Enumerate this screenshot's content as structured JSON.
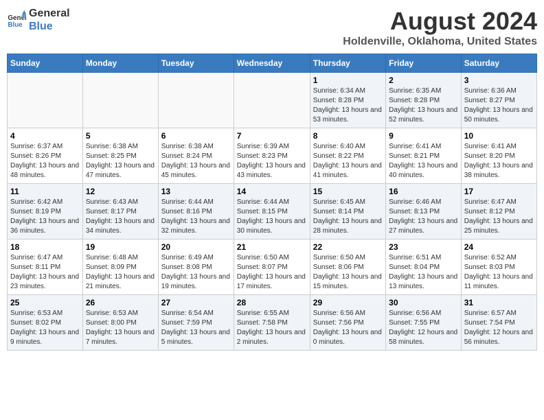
{
  "logo": {
    "line1": "General",
    "line2": "Blue"
  },
  "title": "August 2024",
  "subtitle": "Holdenville, Oklahoma, United States",
  "days_of_week": [
    "Sunday",
    "Monday",
    "Tuesday",
    "Wednesday",
    "Thursday",
    "Friday",
    "Saturday"
  ],
  "weeks": [
    [
      {
        "day": "",
        "sunrise": "",
        "sunset": "",
        "daylight": ""
      },
      {
        "day": "",
        "sunrise": "",
        "sunset": "",
        "daylight": ""
      },
      {
        "day": "",
        "sunrise": "",
        "sunset": "",
        "daylight": ""
      },
      {
        "day": "",
        "sunrise": "",
        "sunset": "",
        "daylight": ""
      },
      {
        "day": "1",
        "sunrise": "Sunrise: 6:34 AM",
        "sunset": "Sunset: 8:28 PM",
        "daylight": "Daylight: 13 hours and 53 minutes."
      },
      {
        "day": "2",
        "sunrise": "Sunrise: 6:35 AM",
        "sunset": "Sunset: 8:28 PM",
        "daylight": "Daylight: 13 hours and 52 minutes."
      },
      {
        "day": "3",
        "sunrise": "Sunrise: 6:36 AM",
        "sunset": "Sunset: 8:27 PM",
        "daylight": "Daylight: 13 hours and 50 minutes."
      }
    ],
    [
      {
        "day": "4",
        "sunrise": "Sunrise: 6:37 AM",
        "sunset": "Sunset: 8:26 PM",
        "daylight": "Daylight: 13 hours and 48 minutes."
      },
      {
        "day": "5",
        "sunrise": "Sunrise: 6:38 AM",
        "sunset": "Sunset: 8:25 PM",
        "daylight": "Daylight: 13 hours and 47 minutes."
      },
      {
        "day": "6",
        "sunrise": "Sunrise: 6:38 AM",
        "sunset": "Sunset: 8:24 PM",
        "daylight": "Daylight: 13 hours and 45 minutes."
      },
      {
        "day": "7",
        "sunrise": "Sunrise: 6:39 AM",
        "sunset": "Sunset: 8:23 PM",
        "daylight": "Daylight: 13 hours and 43 minutes."
      },
      {
        "day": "8",
        "sunrise": "Sunrise: 6:40 AM",
        "sunset": "Sunset: 8:22 PM",
        "daylight": "Daylight: 13 hours and 41 minutes."
      },
      {
        "day": "9",
        "sunrise": "Sunrise: 6:41 AM",
        "sunset": "Sunset: 8:21 PM",
        "daylight": "Daylight: 13 hours and 40 minutes."
      },
      {
        "day": "10",
        "sunrise": "Sunrise: 6:41 AM",
        "sunset": "Sunset: 8:20 PM",
        "daylight": "Daylight: 13 hours and 38 minutes."
      }
    ],
    [
      {
        "day": "11",
        "sunrise": "Sunrise: 6:42 AM",
        "sunset": "Sunset: 8:19 PM",
        "daylight": "Daylight: 13 hours and 36 minutes."
      },
      {
        "day": "12",
        "sunrise": "Sunrise: 6:43 AM",
        "sunset": "Sunset: 8:17 PM",
        "daylight": "Daylight: 13 hours and 34 minutes."
      },
      {
        "day": "13",
        "sunrise": "Sunrise: 6:44 AM",
        "sunset": "Sunset: 8:16 PM",
        "daylight": "Daylight: 13 hours and 32 minutes."
      },
      {
        "day": "14",
        "sunrise": "Sunrise: 6:44 AM",
        "sunset": "Sunset: 8:15 PM",
        "daylight": "Daylight: 13 hours and 30 minutes."
      },
      {
        "day": "15",
        "sunrise": "Sunrise: 6:45 AM",
        "sunset": "Sunset: 8:14 PM",
        "daylight": "Daylight: 13 hours and 28 minutes."
      },
      {
        "day": "16",
        "sunrise": "Sunrise: 6:46 AM",
        "sunset": "Sunset: 8:13 PM",
        "daylight": "Daylight: 13 hours and 27 minutes."
      },
      {
        "day": "17",
        "sunrise": "Sunrise: 6:47 AM",
        "sunset": "Sunset: 8:12 PM",
        "daylight": "Daylight: 13 hours and 25 minutes."
      }
    ],
    [
      {
        "day": "18",
        "sunrise": "Sunrise: 6:47 AM",
        "sunset": "Sunset: 8:11 PM",
        "daylight": "Daylight: 13 hours and 23 minutes."
      },
      {
        "day": "19",
        "sunrise": "Sunrise: 6:48 AM",
        "sunset": "Sunset: 8:09 PM",
        "daylight": "Daylight: 13 hours and 21 minutes."
      },
      {
        "day": "20",
        "sunrise": "Sunrise: 6:49 AM",
        "sunset": "Sunset: 8:08 PM",
        "daylight": "Daylight: 13 hours and 19 minutes."
      },
      {
        "day": "21",
        "sunrise": "Sunrise: 6:50 AM",
        "sunset": "Sunset: 8:07 PM",
        "daylight": "Daylight: 13 hours and 17 minutes."
      },
      {
        "day": "22",
        "sunrise": "Sunrise: 6:50 AM",
        "sunset": "Sunset: 8:06 PM",
        "daylight": "Daylight: 13 hours and 15 minutes."
      },
      {
        "day": "23",
        "sunrise": "Sunrise: 6:51 AM",
        "sunset": "Sunset: 8:04 PM",
        "daylight": "Daylight: 13 hours and 13 minutes."
      },
      {
        "day": "24",
        "sunrise": "Sunrise: 6:52 AM",
        "sunset": "Sunset: 8:03 PM",
        "daylight": "Daylight: 13 hours and 11 minutes."
      }
    ],
    [
      {
        "day": "25",
        "sunrise": "Sunrise: 6:53 AM",
        "sunset": "Sunset: 8:02 PM",
        "daylight": "Daylight: 13 hours and 9 minutes."
      },
      {
        "day": "26",
        "sunrise": "Sunrise: 6:53 AM",
        "sunset": "Sunset: 8:00 PM",
        "daylight": "Daylight: 13 hours and 7 minutes."
      },
      {
        "day": "27",
        "sunrise": "Sunrise: 6:54 AM",
        "sunset": "Sunset: 7:59 PM",
        "daylight": "Daylight: 13 hours and 5 minutes."
      },
      {
        "day": "28",
        "sunrise": "Sunrise: 6:55 AM",
        "sunset": "Sunset: 7:58 PM",
        "daylight": "Daylight: 13 hours and 2 minutes."
      },
      {
        "day": "29",
        "sunrise": "Sunrise: 6:56 AM",
        "sunset": "Sunset: 7:56 PM",
        "daylight": "Daylight: 13 hours and 0 minutes."
      },
      {
        "day": "30",
        "sunrise": "Sunrise: 6:56 AM",
        "sunset": "Sunset: 7:55 PM",
        "daylight": "Daylight: 12 hours and 58 minutes."
      },
      {
        "day": "31",
        "sunrise": "Sunrise: 6:57 AM",
        "sunset": "Sunset: 7:54 PM",
        "daylight": "Daylight: 12 hours and 56 minutes."
      }
    ]
  ]
}
